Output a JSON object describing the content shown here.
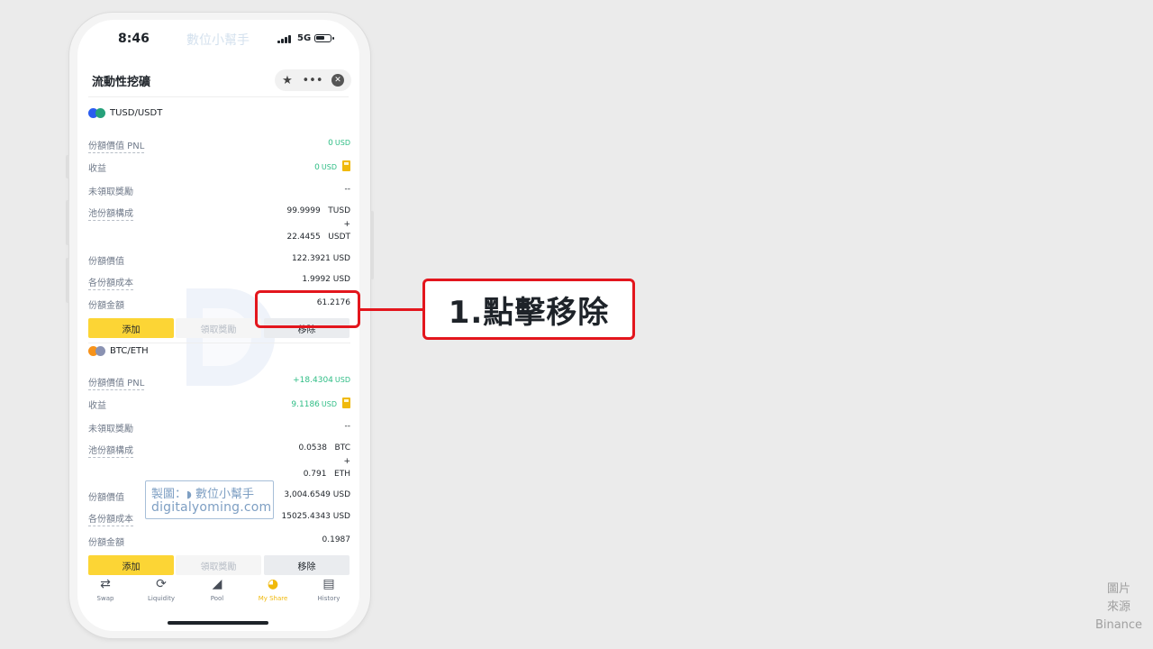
{
  "status_bar": {
    "time": "8:46",
    "watermark": "數位小幫手",
    "network": "5G"
  },
  "header": {
    "title": "流動性挖礦"
  },
  "positions": [
    {
      "pair": "TUSD/USDT",
      "pnl_label": "份額價值 PNL",
      "pnl_value": "0",
      "pnl_unit": "USD",
      "earnings_label": "收益",
      "earnings_value": "0",
      "earnings_unit": "USD",
      "unclaimed_label": "未領取獎勵",
      "unclaimed_value": "--",
      "composition_label": "池份額構成",
      "composition_line1": "99.9999   TUSD",
      "composition_plus": "+",
      "composition_line2": "22.4455   USDT",
      "share_value_label": "份額價值",
      "share_value": "122.3921 USD",
      "cost_label": "各份額成本",
      "cost_value": "1.9992 USD",
      "amount_label": "份額金額",
      "amount_value": "61.2176",
      "btn_add": "添加",
      "btn_claim": "領取獎勵",
      "btn_remove": "移除"
    },
    {
      "pair": "BTC/ETH",
      "pnl_label": "份額價值 PNL",
      "pnl_value": "+18.4304",
      "pnl_unit": "USD",
      "earnings_label": "收益",
      "earnings_value": "9.1186",
      "earnings_unit": "USD",
      "unclaimed_label": "未領取獎勵",
      "unclaimed_value": "--",
      "composition_label": "池份額構成",
      "composition_line1": "0.0538   BTC",
      "composition_plus": "+",
      "composition_line2": "0.791   ETH",
      "share_value_label": "份額價值",
      "share_value": "3,004.6549 USD",
      "cost_label": "各份額成本",
      "cost_value": "15025.4343 USD",
      "amount_label": "份額金額",
      "amount_value": "0.1987",
      "btn_add": "添加",
      "btn_claim": "領取獎勵",
      "btn_remove": "移除"
    }
  ],
  "tabs": [
    {
      "label": "Swap",
      "icon": "swap-icon"
    },
    {
      "label": "Liquidity",
      "icon": "liquidity-icon"
    },
    {
      "label": "Pool",
      "icon": "pool-icon"
    },
    {
      "label": "My Share",
      "icon": "my-share-icon",
      "active": true
    },
    {
      "label": "History",
      "icon": "history-icon"
    }
  ],
  "watermark_box": {
    "line1": "製圖：",
    "line1_brand": "數位小幫手",
    "line2": "digitalyoming.com"
  },
  "callout": {
    "text": "1.點擊移除"
  },
  "credit": {
    "line1": "圖片",
    "line2": "來源",
    "line3": "Binance"
  },
  "colors": {
    "accent": "#fcd535",
    "positive": "#2ebd85",
    "highlight": "#e3161d"
  }
}
